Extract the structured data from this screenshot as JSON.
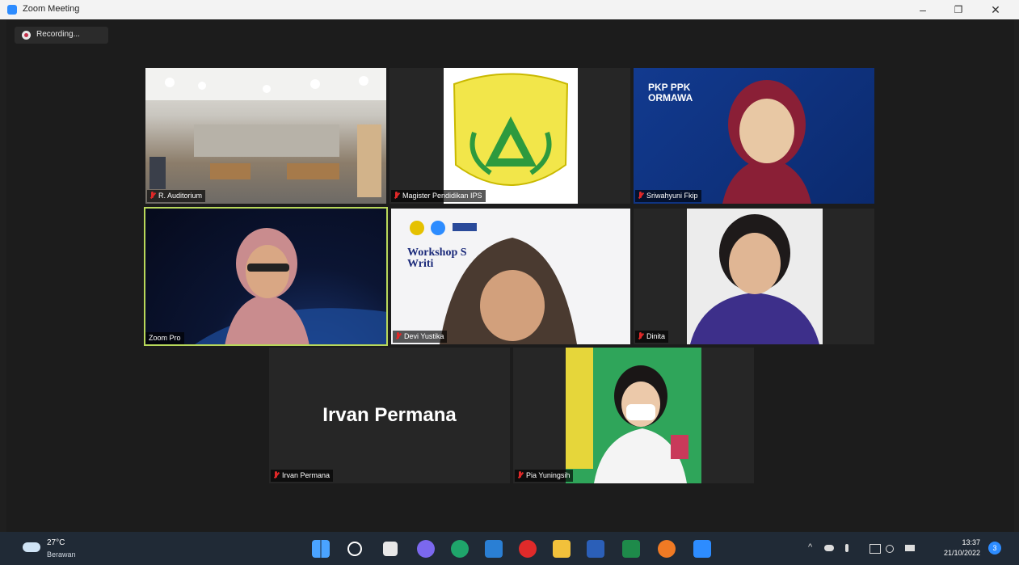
{
  "window": {
    "title": "Zoom Meeting",
    "min": "–",
    "max": "❐",
    "close": "✕"
  },
  "recording": {
    "label": "Recording..."
  },
  "participants": [
    {
      "name": "R. Auditorium"
    },
    {
      "name": "Magister Pendidikan IPS"
    },
    {
      "name": "Sriwahyuni Fkip",
      "banner": "PKP PPK ORMAWA"
    },
    {
      "name": "Zoom Pro"
    },
    {
      "name": "Devi Yustika",
      "banner": "Workshop S Writi"
    },
    {
      "name": "Dinita"
    },
    {
      "name": "Irvan Permana",
      "display": "Irvan Permana"
    },
    {
      "name": "Pia Yuningsih"
    }
  ],
  "taskbar": {
    "weather_temp": "27°C",
    "weather_desc": "Berawan",
    "time": "13:37",
    "date": "21/10/2022",
    "notif_count": "3"
  },
  "colors": {
    "active_speaker": "#b8d85a",
    "zoom_blue": "#2d8cff"
  }
}
